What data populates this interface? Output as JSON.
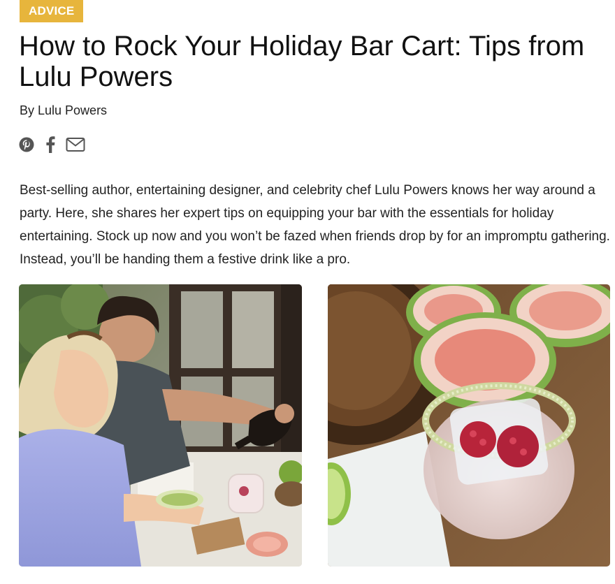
{
  "article": {
    "category": "ADVICE",
    "title": "How to Rock Your Holiday Bar Cart: Tips from Lulu Powers",
    "byline": "By Lulu Powers",
    "intro": "Best-selling author, entertaining designer, and celebrity chef Lulu Powers knows her way around a party. Here, she shares her expert tips on equipping your bar with the essentials for holiday entertaining. Stock up now and you won’t be fazed when friends drop by for an impromptu gathering. Instead, you’ll be handing them a festive drink like a pro."
  },
  "share": {
    "icons": [
      "pinterest-icon",
      "facebook-icon",
      "email-icon"
    ]
  },
  "colors": {
    "badge": "#e7b53c",
    "text": "#222222"
  }
}
